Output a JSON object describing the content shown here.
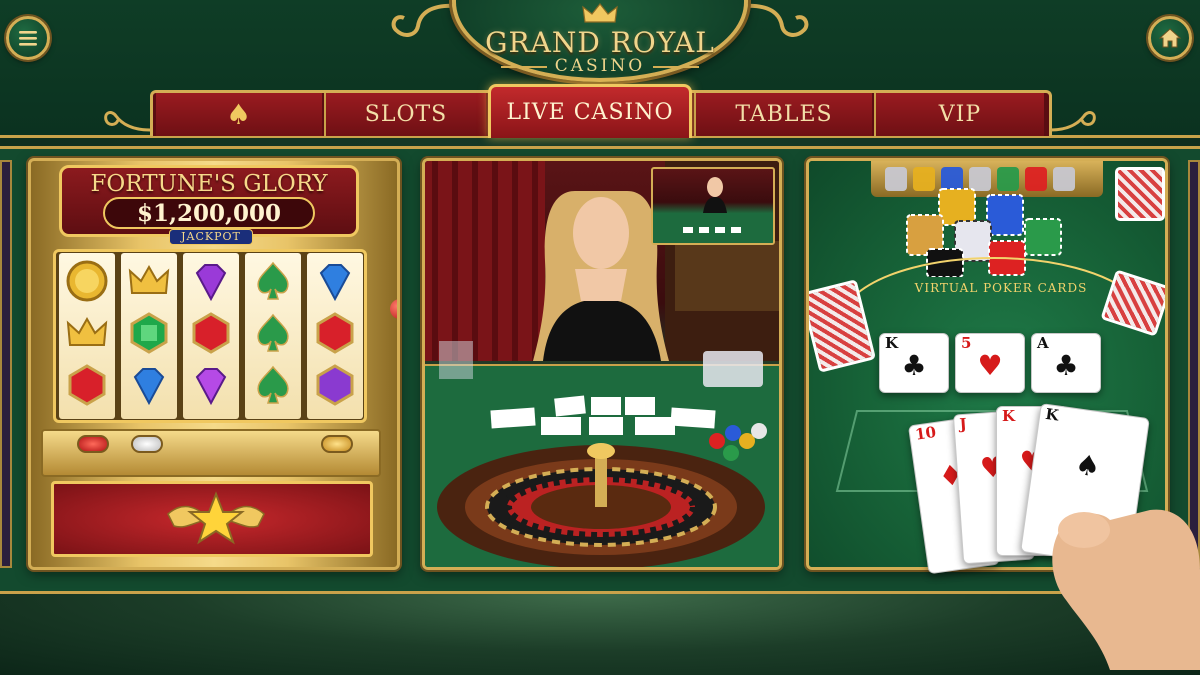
{
  "brand": {
    "title": "GRAND ROYAL",
    "subtitle": "CASINO"
  },
  "header": {
    "menu_icon": "hamburger-menu-icon",
    "home_icon": "home-icon"
  },
  "tabs": [
    {
      "label": "♠",
      "icon": "spade-icon",
      "active": false
    },
    {
      "label": "SLOTS",
      "active": false
    },
    {
      "label": "LIVE CASINO",
      "active": true
    },
    {
      "label": "TABLES",
      "active": false
    },
    {
      "label": "VIP",
      "active": false
    }
  ],
  "slot_game": {
    "name": "FORTUNE'S GLORY",
    "jackpot_amount": "$1,200,000",
    "jackpot_label": "JACKPOT",
    "reels": [
      [
        "gold-coin",
        "crown",
        "ruby"
      ],
      [
        "crown",
        "emerald",
        "sapphire"
      ],
      [
        "amethyst",
        "ruby",
        "amethyst"
      ],
      [
        "green-spade",
        "green-spade",
        "green-spade"
      ],
      [
        "sapphire",
        "ruby",
        "amethyst"
      ]
    ]
  },
  "live_casino": {
    "inset_label": "Live dealer preview"
  },
  "poker": {
    "table_label": "VIRTUAL POKER CARDS",
    "community_cards": [
      {
        "rank": "K",
        "suit": "♣"
      },
      {
        "rank": "5",
        "suit": "♥"
      },
      {
        "rank": "A",
        "suit": "♣"
      }
    ],
    "hand_cards": [
      {
        "rank": "10",
        "suit": "♦"
      },
      {
        "rank": "J",
        "suit": "♥"
      },
      {
        "rank": "K",
        "suit": "♥"
      },
      {
        "rank": "K",
        "suit": "♠"
      }
    ]
  },
  "colors": {
    "felt_green": "#134a2e",
    "gold": "#d4ae55",
    "tab_red": "#9a1b20",
    "active_tab": "#c22a2c"
  }
}
